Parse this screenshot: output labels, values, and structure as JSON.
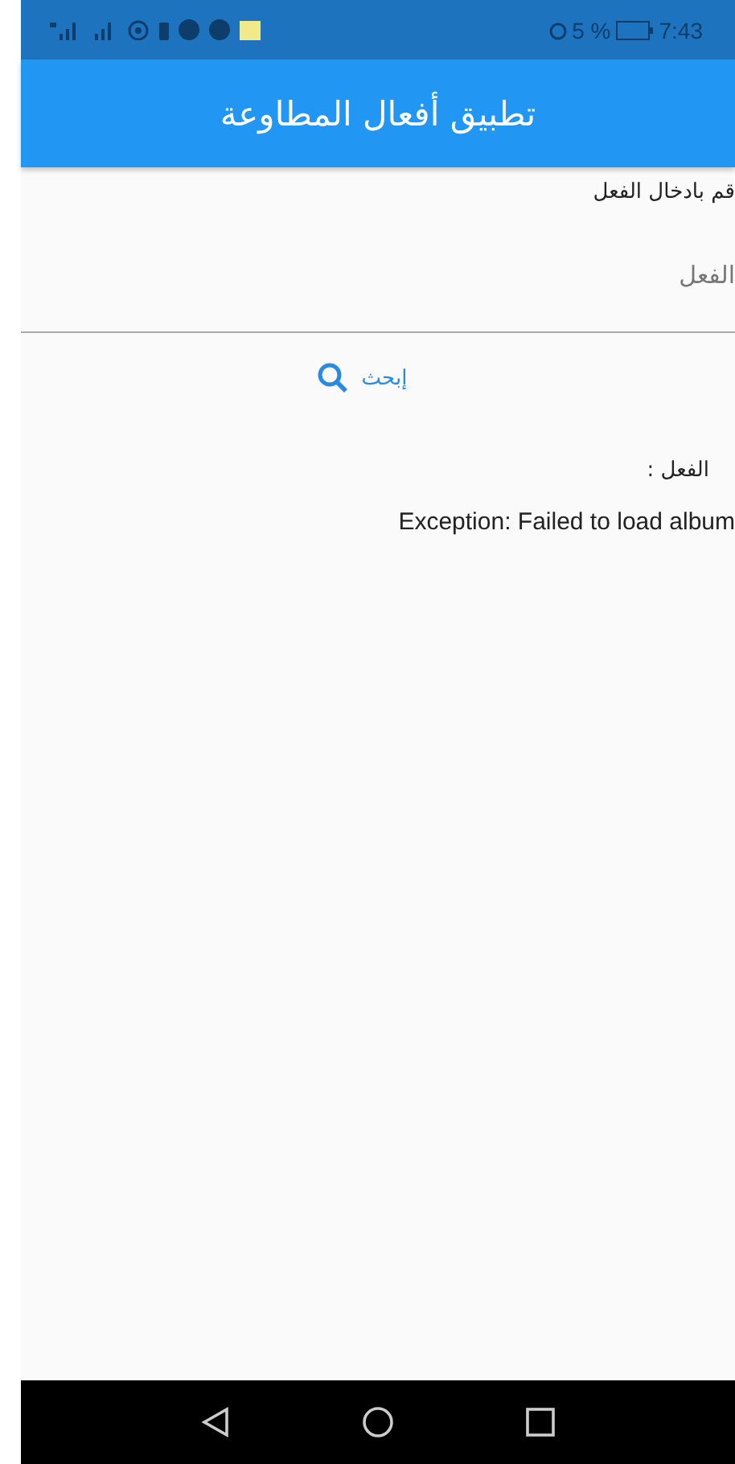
{
  "status_bar": {
    "battery": "5 %",
    "time": "7:43"
  },
  "app_bar": {
    "title": "تطبيق أفعال المطاوعة"
  },
  "verb_field": {
    "label": "قم بادخال الفعل",
    "placeholder": "الفعل"
  },
  "search_button": {
    "label": "إبحث"
  },
  "result": {
    "label": "الفعل :",
    "error": "Exception: Failed to load album"
  }
}
